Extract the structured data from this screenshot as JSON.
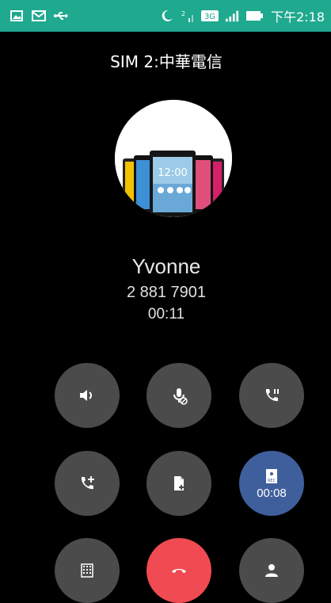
{
  "status_bar": {
    "time": "下午2:18",
    "left_icons": [
      "image-icon",
      "mail-icon",
      "usb-icon"
    ],
    "right_icons": [
      "moon-icon",
      "sim-signal-icon",
      "3g-icon",
      "signal-icon",
      "battery-icon"
    ],
    "network_type": "3G"
  },
  "call": {
    "sim_label": "SIM 2:中華電信",
    "caller_name": "Yvonne",
    "caller_number": "2 881 7901",
    "duration": "00:11"
  },
  "controls": {
    "recording_time": "00:08",
    "buttons": [
      "speaker-icon",
      "mute-icon",
      "hold-icon",
      "add-call-icon",
      "note-icon",
      "record-icon",
      "dialpad-icon",
      "end-call-icon",
      "contacts-icon"
    ]
  },
  "colors": {
    "status_bar": "#1fa98f",
    "button_bg": "#4b4b4b",
    "record_button": "#3f5f9c",
    "end_call": "#f04b52"
  }
}
